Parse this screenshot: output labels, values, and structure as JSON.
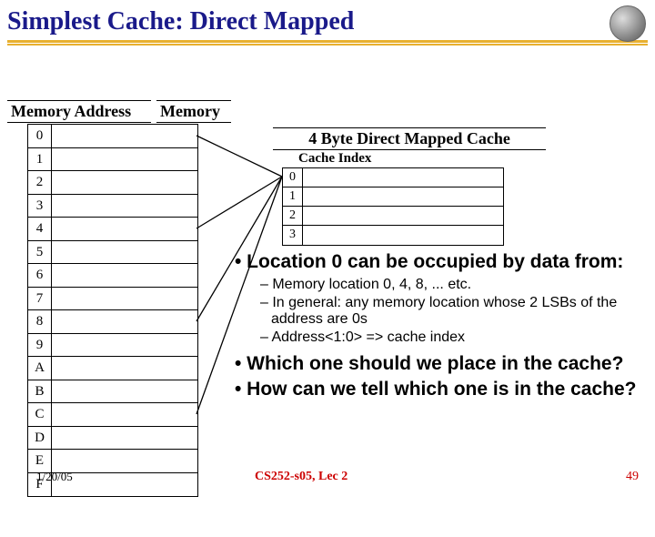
{
  "title": "Simplest Cache: Direct Mapped",
  "headers": {
    "memory_address": "Memory Address",
    "memory": "Memory",
    "cache_title": "4 Byte Direct Mapped Cache",
    "cache_index": "Cache Index"
  },
  "memory_rows": [
    "0",
    "1",
    "2",
    "3",
    "4",
    "5",
    "6",
    "7",
    "8",
    "9",
    "A",
    "B",
    "C",
    "D",
    "E",
    "F"
  ],
  "cache_rows": [
    "0",
    "1",
    "2",
    "3"
  ],
  "bullets": {
    "b1": "• Location 0 can be occupied by data from:",
    "b1a": "– Memory location 0, 4, 8, ... etc.",
    "b1b": "– In general: any memory location whose 2 LSBs of the address are 0s",
    "b1c": "– Address<1:0> => cache index",
    "b2": "• Which one should we place in the cache?",
    "b3": "• How can we tell which one is in the cache?"
  },
  "footer": {
    "date": "1/20/05",
    "center": "CS252-s05, Lec 2",
    "page": "49"
  }
}
